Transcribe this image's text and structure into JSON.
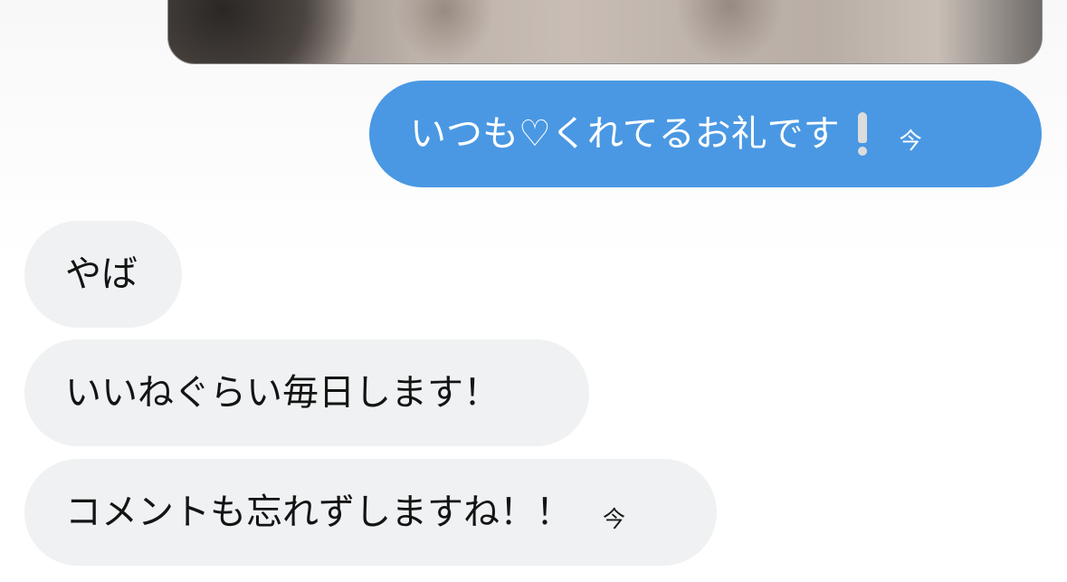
{
  "messages": [
    {
      "role": "sent",
      "text": "いつも♡くれてるお礼です",
      "emoji": "exclamation-emoji",
      "time": "今"
    },
    {
      "role": "received",
      "text": "やば"
    },
    {
      "role": "received",
      "text": "いいねぐらい毎日します！"
    },
    {
      "role": "received",
      "text": "コメントも忘れずしますね！！",
      "time": "今"
    }
  ],
  "colors": {
    "sent_bubble": "#4a98e3",
    "received_bubble": "#eff1f2",
    "background": "#ffffff"
  }
}
